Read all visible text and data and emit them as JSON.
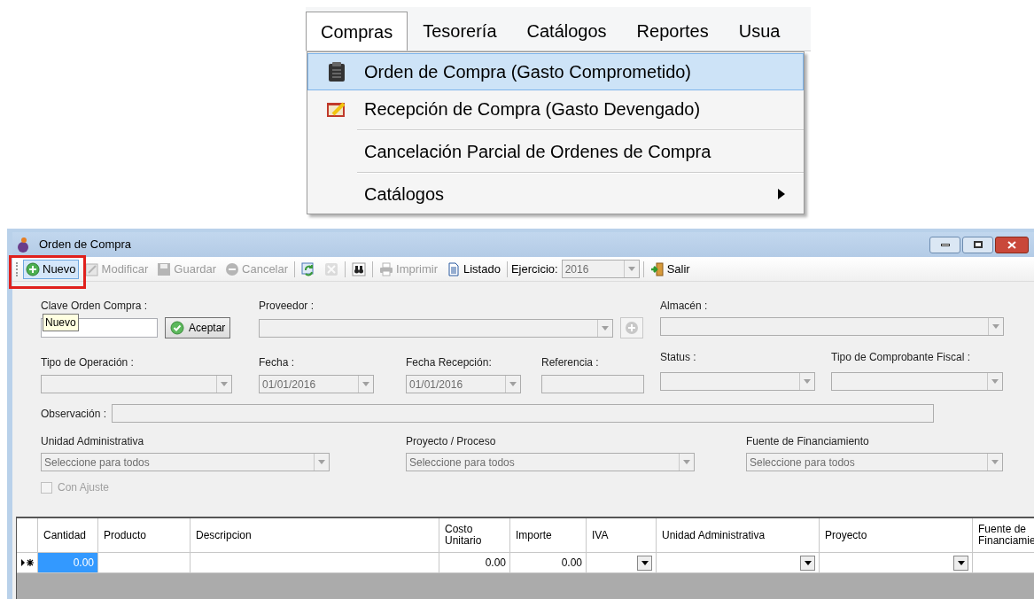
{
  "menu_bar": [
    {
      "label": "Compras",
      "selected": true
    },
    {
      "label": "Tesorería",
      "selected": false
    },
    {
      "label": "Catálogos",
      "selected": false
    },
    {
      "label": "Reportes",
      "selected": false
    },
    {
      "label": "Usua",
      "selected": false
    }
  ],
  "dropdown": [
    {
      "kind": "item",
      "label": "Orden de Compra (Gasto Comprometido)",
      "selected": true
    },
    {
      "kind": "item",
      "label": "Recepción de Compra (Gasto Devengado)",
      "selected": false
    },
    {
      "kind": "separator"
    },
    {
      "kind": "item",
      "label": "Cancelación Parcial de Ordenes de Compra",
      "selected": false
    },
    {
      "kind": "separator"
    },
    {
      "kind": "submenu",
      "label": "Catálogos",
      "selected": false
    }
  ],
  "window": {
    "title": "Orden de Compra"
  },
  "toolbar": [
    {
      "kind": "button",
      "label": "Nuevo",
      "disabled": false,
      "selected": true
    },
    {
      "kind": "button",
      "label": "Modificar",
      "disabled": true,
      "selected": false
    },
    {
      "kind": "button",
      "label": "Guardar",
      "disabled": true,
      "selected": false
    },
    {
      "kind": "button",
      "label": "Cancelar",
      "disabled": true,
      "selected": false
    },
    {
      "kind": "separator"
    },
    {
      "kind": "icon_button",
      "disabled": false,
      "selected": false
    },
    {
      "kind": "icon_button",
      "disabled": true,
      "selected": false
    },
    {
      "kind": "separator"
    },
    {
      "kind": "icon_button",
      "disabled": false,
      "selected": false
    },
    {
      "kind": "separator"
    },
    {
      "kind": "button",
      "label": "Imprimir",
      "disabled": true,
      "selected": false
    },
    {
      "kind": "button",
      "label": "Listado",
      "disabled": false,
      "selected": false
    },
    {
      "kind": "separator"
    },
    {
      "kind": "combo",
      "label": "Ejercicio:",
      "value": "2016",
      "disabled": true
    },
    {
      "kind": "separator"
    },
    {
      "kind": "button",
      "label": "Salir",
      "disabled": false,
      "selected": false
    }
  ],
  "tooltip": "Nuevo",
  "form": {
    "clave": {
      "label": "Clave Orden Compra :"
    },
    "accept_button": "Aceptar",
    "proveedor": {
      "label": "Proveedor :",
      "disabled": true
    },
    "almacen": {
      "label": "Almacén :",
      "disabled": true
    },
    "tipo_operacion": {
      "label": "Tipo de Operación :",
      "disabled": true
    },
    "fecha": {
      "label": "Fecha :",
      "value": "01/01/2016",
      "disabled": true
    },
    "fecha_recepcion": {
      "label": "Fecha Recepción:",
      "value": "01/01/2016",
      "disabled": true
    },
    "referencia": {
      "label": "Referencia :",
      "disabled": true
    },
    "status": {
      "label": "Status :",
      "disabled": true
    },
    "tipo_comprobante": {
      "label": "Tipo de Comprobante Fiscal :",
      "disabled": true
    },
    "observacion": {
      "label": "Observación :",
      "disabled": true
    },
    "unidad": {
      "label": "Unidad Administrativa",
      "value": "Seleccione para todos",
      "disabled": true
    },
    "proyecto": {
      "label": "Proyecto / Proceso",
      "value": "Seleccione para todos",
      "disabled": true
    },
    "fuente": {
      "label": "Fuente de Financiamiento",
      "value": "Seleccione para todos",
      "disabled": true
    },
    "con_ajuste": {
      "label": "Con Ajuste",
      "checked": false,
      "disabled": true
    }
  },
  "grid": {
    "columns": [
      "Cantidad",
      "Producto",
      "Descripcion",
      "Costo Unitario",
      "Importe",
      "IVA",
      "Unidad Administrativa",
      "Proyecto",
      "Fuente de Financiamie"
    ],
    "rows": [
      {
        "new_row": true,
        "cells": [
          {
            "kind": "text",
            "value": "0.00",
            "selected": true
          },
          {
            "kind": "text",
            "selected": false
          },
          {
            "kind": "text",
            "selected": false
          },
          {
            "kind": "text",
            "value": "0.00",
            "selected": false
          },
          {
            "kind": "text",
            "value": "0.00",
            "selected": false
          },
          {
            "kind": "combo",
            "selected": false
          },
          {
            "kind": "combo",
            "selected": false
          },
          {
            "kind": "combo",
            "selected": false
          },
          {
            "kind": "text",
            "selected": false
          }
        ]
      }
    ]
  }
}
